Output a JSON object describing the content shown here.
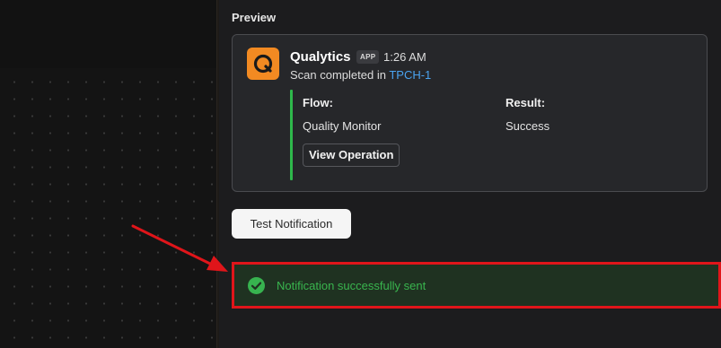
{
  "preview": {
    "label": "Preview"
  },
  "message": {
    "app_name": "Qualytics",
    "app_badge": "APP",
    "time": "1:26 AM",
    "scan_prefix": "Scan completed in ",
    "scan_target": "TPCH-1",
    "fields": {
      "flow_title": "Flow:",
      "flow_value": "Quality Monitor",
      "result_title": "Result:",
      "result_value": "Success"
    },
    "view_button": "View Operation",
    "accent_color": "#2eb84b",
    "app_icon_color": "#f28a22"
  },
  "test_button": {
    "label": "Test Notification"
  },
  "status": {
    "text": "Notification successfully sent",
    "icon": "check-circle-icon",
    "color": "#39b54e"
  },
  "annotation": {
    "highlight_color": "#e0151a",
    "arrow_icon": "red-arrow-icon"
  }
}
